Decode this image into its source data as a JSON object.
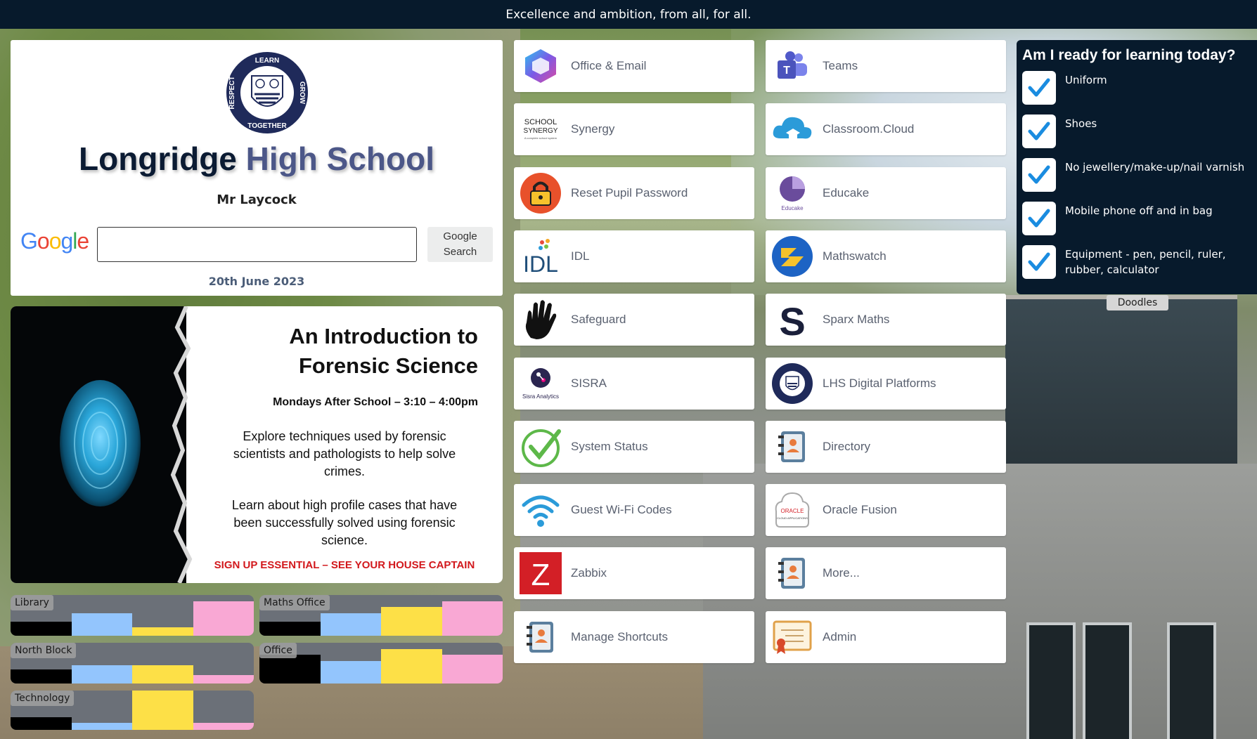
{
  "top_bar": {
    "motto": "Excellence and ambition, from all, for all."
  },
  "header": {
    "logo_words": [
      "LEARN",
      "GROW",
      "TOGETHER",
      "RESPECT"
    ],
    "school_first": "Longridge",
    "school_second": "High School",
    "user_name": "Mr Laycock",
    "search_button_label": "Google Search",
    "google_letters": [
      "G",
      "o",
      "o",
      "g",
      "l",
      "e"
    ],
    "date": "20th June 2023"
  },
  "poster": {
    "title_line1": "An Introduction to",
    "title_line2": "Forensic Science",
    "subtitle": "Mondays After School – 3:10 – 4:00pm",
    "para1": "Explore techniques used by forensic scientists and pathologists to help solve crimes.",
    "para2": "Learn about high profile cases that have been successfully solved using forensic science.",
    "signup": "SIGN UP ESSENTIAL – SEE YOUR HOUSE CAPTAIN"
  },
  "rooms": [
    {
      "name": "Library",
      "levels": [
        0.35,
        0.55,
        0.2,
        0.85
      ]
    },
    {
      "name": "Maths Office",
      "levels": [
        0.35,
        0.55,
        0.7,
        0.85
      ]
    },
    {
      "name": "North Block",
      "levels": [
        0.35,
        0.45,
        0.45,
        0.2
      ]
    },
    {
      "name": "Office",
      "levels": [
        0.7,
        0.55,
        0.85,
        0.7
      ]
    },
    {
      "name": "Technology",
      "levels": [
        0.35,
        0.2,
        1.0,
        0.2
      ]
    }
  ],
  "room_colors": [
    "#000000",
    "#93c5fd",
    "#fde047",
    "#f9a8d4"
  ],
  "shortcuts_left": [
    {
      "label": "Office & Email",
      "icon": "microsoft-365-icon"
    },
    {
      "label": "Synergy",
      "icon": "school-synergy-icon"
    },
    {
      "label": "Reset Pupil Password",
      "icon": "padlock-icon"
    },
    {
      "label": "IDL",
      "icon": "idl-icon"
    },
    {
      "label": "Safeguard",
      "icon": "handprint-icon"
    },
    {
      "label": "SISRA",
      "icon": "sisra-icon"
    },
    {
      "label": "System Status",
      "icon": "checkmark-icon"
    },
    {
      "label": "Guest Wi-Fi Codes",
      "icon": "wifi-icon"
    },
    {
      "label": "Zabbix",
      "icon": "zabbix-icon"
    },
    {
      "label": "Manage Shortcuts",
      "icon": "address-book-icon"
    }
  ],
  "shortcuts_right": [
    {
      "label": "Teams",
      "icon": "teams-icon"
    },
    {
      "label": "Classroom.Cloud",
      "icon": "cloud-icon"
    },
    {
      "label": "Educake",
      "icon": "educake-icon"
    },
    {
      "label": "Mathswatch",
      "icon": "mathswatch-icon"
    },
    {
      "label": "Sparx Maths",
      "icon": "sparx-icon"
    },
    {
      "label": "LHS Digital Platforms",
      "icon": "school-crest-icon"
    },
    {
      "label": "Directory",
      "icon": "address-book-icon"
    },
    {
      "label": "Oracle Fusion",
      "icon": "oracle-icon"
    },
    {
      "label": "More...",
      "icon": "address-book-icon"
    },
    {
      "label": "Admin",
      "icon": "certificate-icon"
    }
  ],
  "icon_text": {
    "synergy": [
      "SCHOOL",
      "SYNERGY",
      "A complete school system"
    ],
    "idl": "IDL",
    "sisra": "Sisra Analytics",
    "zabbix": "Z",
    "sparx": "S",
    "educake": "Educake",
    "oracle": [
      "ORACLE",
      "CLOUD APPLICATIONS"
    ]
  },
  "checklist": {
    "title": "Am I ready for learning today?",
    "items": [
      "Uniform",
      "Shoes",
      "No jewellery/make-up/nail varnish",
      "Mobile phone off and in bag",
      "Equipment - pen, pencil, ruler, rubber, calculator"
    ]
  },
  "doodles_label": "Doodles"
}
